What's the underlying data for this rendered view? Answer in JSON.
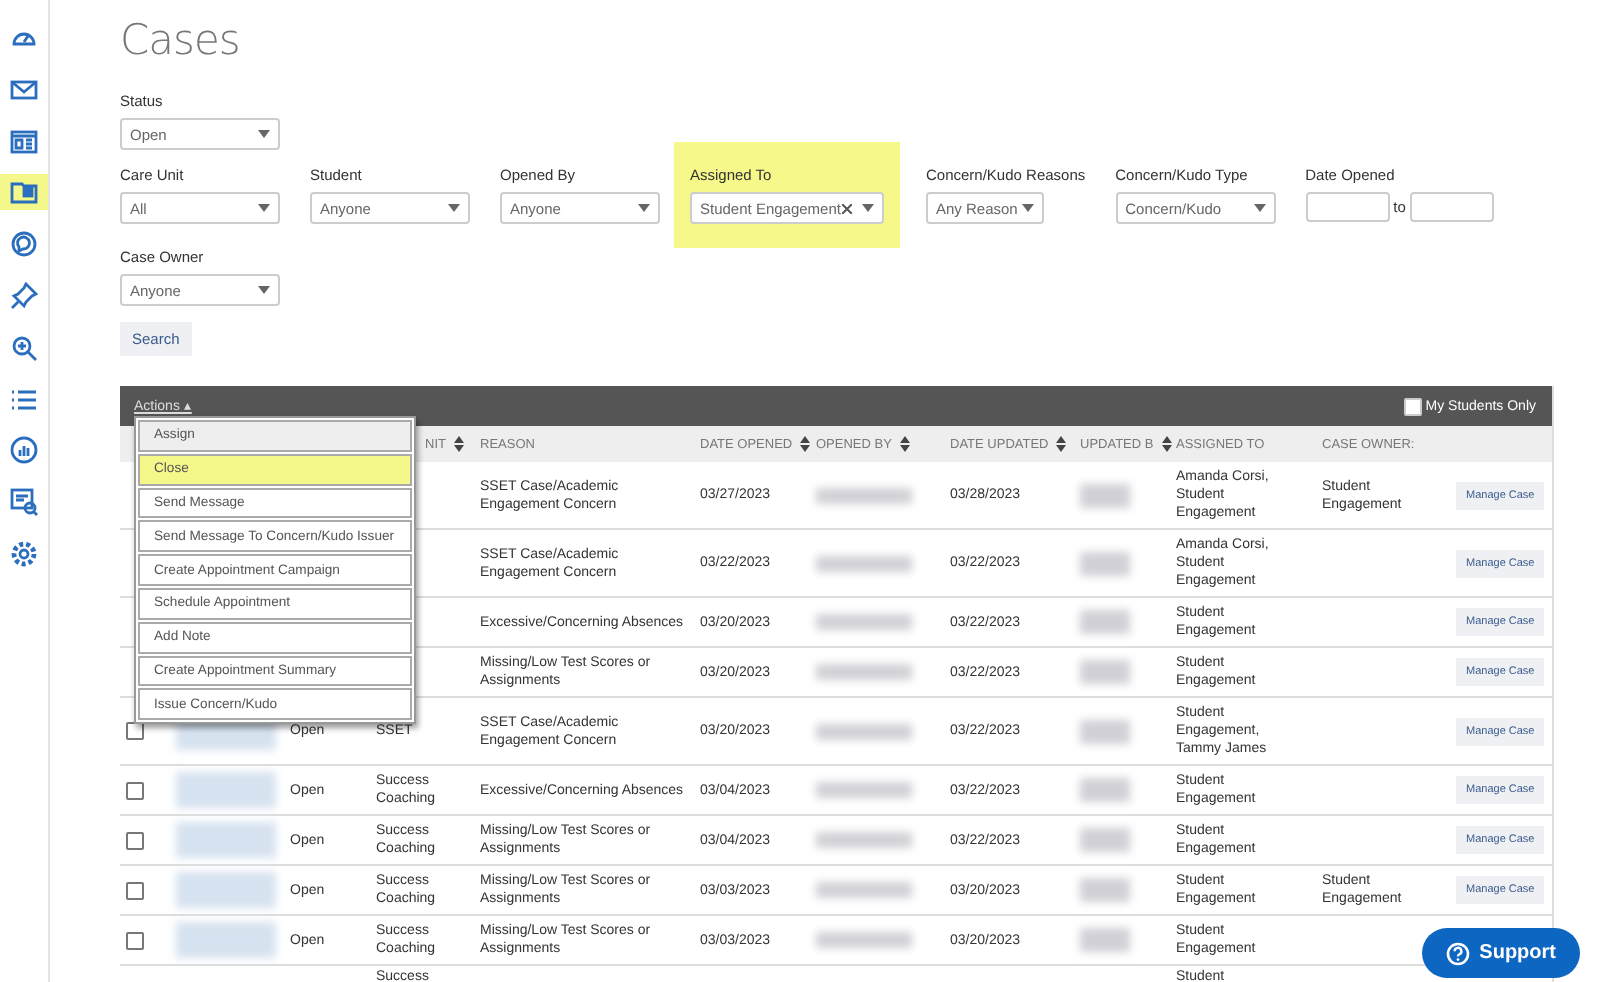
{
  "sidebar": {
    "items": [
      {
        "kind": "gauge",
        "selected": false
      },
      {
        "kind": "envelope",
        "selected": false
      },
      {
        "kind": "card",
        "selected": false
      },
      {
        "kind": "folder",
        "selected": true
      },
      {
        "kind": "chat",
        "selected": false
      },
      {
        "kind": "pin",
        "selected": false
      },
      {
        "kind": "zoom",
        "selected": false
      },
      {
        "kind": "list",
        "selected": false
      },
      {
        "kind": "chart",
        "selected": false
      },
      {
        "kind": "report",
        "selected": false
      },
      {
        "kind": "gear",
        "selected": false
      }
    ]
  },
  "title": "Cases",
  "filters": {
    "status": {
      "label": "Status",
      "value": "Open"
    },
    "row": [
      {
        "kind": "select",
        "label": "Care Unit",
        "value": "All",
        "highlighted": false
      },
      {
        "kind": "select",
        "label": "Student",
        "value": "Anyone",
        "highlighted": false
      },
      {
        "kind": "select",
        "label": "Opened By",
        "value": "Anyone",
        "highlighted": false
      },
      {
        "kind": "tag",
        "label": "Assigned To",
        "value": "Student Engagement",
        "highlighted": true
      },
      {
        "kind": "small",
        "label": "Concern/Kudo Reasons",
        "value": "Any Reason",
        "highlighted": false
      },
      {
        "kind": "select",
        "label": "Concern/Kudo Type",
        "value": "Concern/Kudo",
        "highlighted": false
      },
      {
        "kind": "range",
        "label": "Date Opened",
        "separator": "to",
        "highlighted": false
      }
    ],
    "case_owner": {
      "label": "Case Owner",
      "value": "Anyone"
    },
    "search_button": "Search"
  },
  "table": {
    "actions": "Actions ▴",
    "my_students": {
      "label": "My Students Only",
      "checked": false
    },
    "columns": [
      {
        "label": "NIT",
        "sortable": true
      },
      {
        "label": "REASON",
        "sortable": false
      },
      {
        "label": "DATE OPENED",
        "sortable": true
      },
      {
        "label": "OPENED BY",
        "sortable": true
      },
      {
        "label": "DATE UPDATED",
        "sortable": true
      },
      {
        "label": "UPDATED B",
        "sortable": true
      },
      {
        "label": "ASSIGNED TO",
        "sortable": false
      },
      {
        "label": "CASE OWNER:",
        "sortable": false
      }
    ],
    "rows": [
      {
        "reason": "SSET Case/Academic Engagement Concern",
        "date_opened": "03/27/2023",
        "date_updated": "03/28/2023",
        "assigned_to": "Amanda Corsi, Student Engagement",
        "case_owner": "Student Engagement",
        "manage": "Manage Case"
      },
      {
        "reason": "SSET Case/Academic Engagement Concern",
        "date_opened": "03/22/2023",
        "date_updated": "03/22/2023",
        "assigned_to": "Amanda Corsi, Student Engagement",
        "manage": "Manage Case"
      },
      {
        "reason": "Excessive/Concerning Absences",
        "date_opened": "03/20/2023",
        "date_updated": "03/22/2023",
        "assigned_to": "Student Engagement",
        "manage": "Manage Case"
      },
      {
        "reason": "Missing/Low Test Scores or Assignments",
        "date_opened": "03/20/2023",
        "date_updated": "03/22/2023",
        "assigned_to": "Student Engagement",
        "manage": "Manage Case"
      },
      {
        "checked": false,
        "status": "Open",
        "care_unit": "SSET",
        "reason": "SSET Case/Academic Engagement Concern",
        "date_opened": "03/20/2023",
        "date_updated": "03/22/2023",
        "assigned_to": "Student Engagement, Tammy James",
        "manage": "Manage Case"
      },
      {
        "checked": false,
        "status": "Open",
        "care_unit": "Success Coaching",
        "reason": "Excessive/Concerning Absences",
        "date_opened": "03/04/2023",
        "date_updated": "03/22/2023",
        "assigned_to": "Student Engagement",
        "manage": "Manage Case"
      },
      {
        "checked": false,
        "status": "Open",
        "care_unit": "Success Coaching",
        "reason": "Missing/Low Test Scores or Assignments",
        "date_opened": "03/04/2023",
        "date_updated": "03/22/2023",
        "assigned_to": "Student Engagement",
        "manage": "Manage Case"
      },
      {
        "checked": false,
        "status": "Open",
        "care_unit": "Success Coaching",
        "reason": "Missing/Low Test Scores or Assignments",
        "date_opened": "03/03/2023",
        "date_updated": "03/20/2023",
        "assigned_to": "Student Engagement",
        "case_owner": "Student Engagement",
        "manage": "Manage Case"
      },
      {
        "checked": false,
        "status": "Open",
        "care_unit": "Success Coaching",
        "reason": "Missing/Low Test Scores or Assignments",
        "date_opened": "03/03/2023",
        "date_updated": "03/20/2023",
        "assigned_to": "Student Engagement"
      },
      {
        "care_unit": "Success",
        "assigned_to": "Student"
      }
    ],
    "menu": [
      {
        "label": "Assign",
        "selected": false,
        "hovered": true
      },
      {
        "label": "Close",
        "selected": true,
        "hovered": false
      },
      {
        "label": "Send Message",
        "selected": false,
        "hovered": false
      },
      {
        "label": "Send Message To Concern/Kudo Issuer",
        "selected": false,
        "hovered": false
      },
      {
        "label": "Create Appointment Campaign",
        "selected": false,
        "hovered": false
      },
      {
        "label": "Schedule Appointment",
        "selected": false,
        "hovered": false
      },
      {
        "label": "Add Note",
        "selected": false,
        "hovered": false
      },
      {
        "label": "Create Appointment Summary",
        "selected": false,
        "hovered": false
      },
      {
        "label": "Issue Concern/Kudo",
        "selected": false,
        "hovered": false
      }
    ]
  },
  "support_button": "Support"
}
